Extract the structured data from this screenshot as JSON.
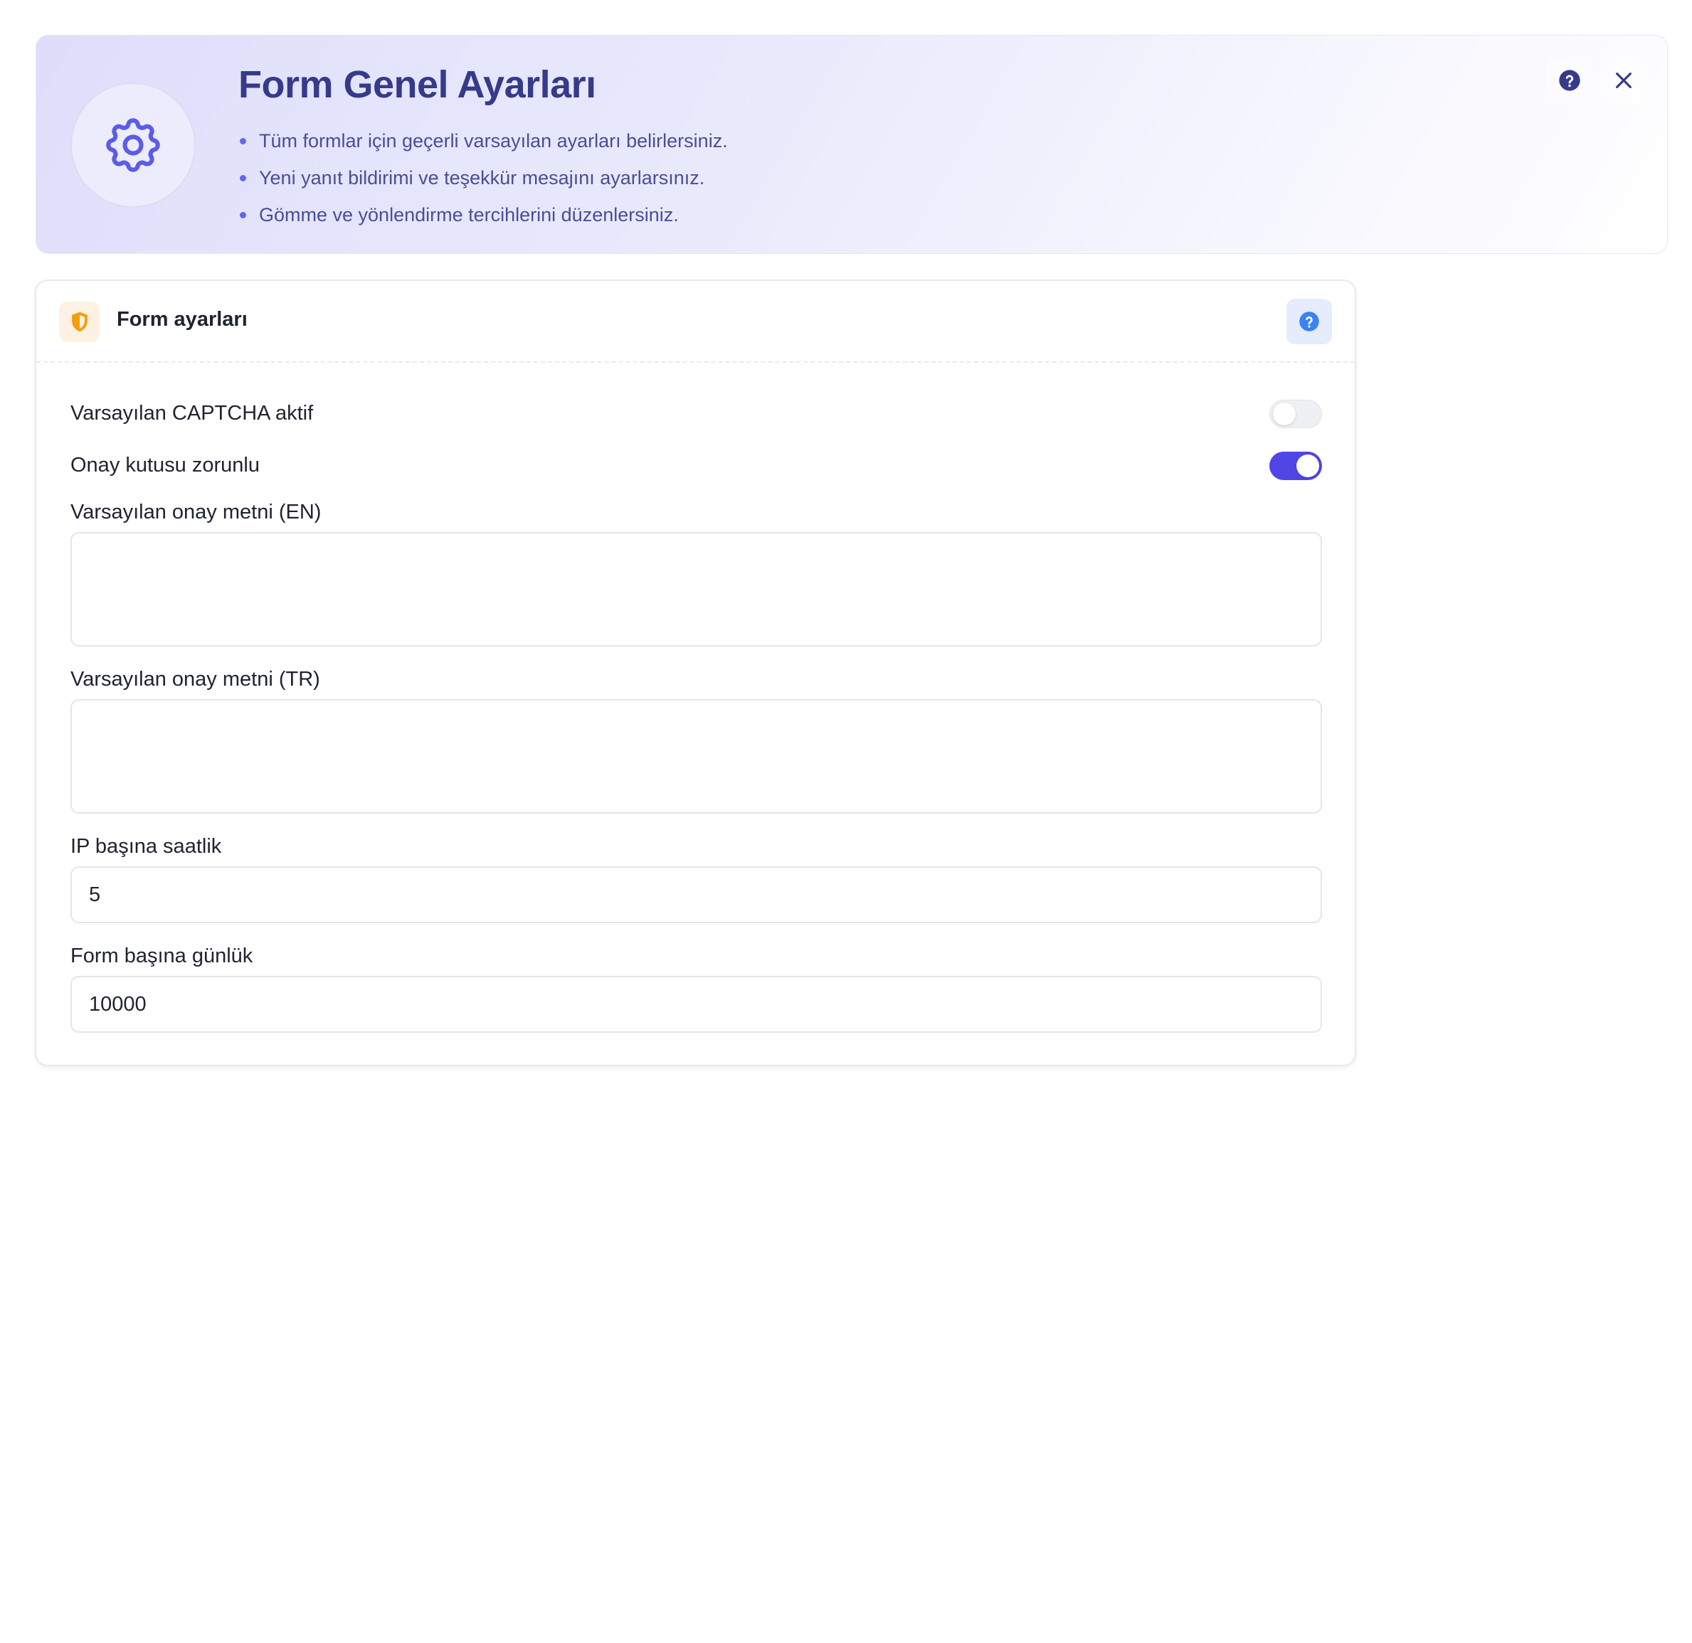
{
  "hero": {
    "title": "Form Genel Ayarları",
    "bullets": [
      "Tüm formlar için geçerli varsayılan ayarları belirlersiniz.",
      "Yeni yanıt bildirimi ve teşekkür mesajını ayarlarsınız.",
      "Gömme ve yönlendirme tercihlerini düzenlersiniz."
    ],
    "icon": "gear-icon",
    "actions": [
      "help-circle-icon",
      "close-icon"
    ]
  },
  "card": {
    "title": "Form ayarları",
    "header_icon": "shield-icon",
    "help_icon": "help-circle-icon",
    "fields": {
      "captcha": {
        "label": "Varsayılan CAPTCHA aktif",
        "enabled": false
      },
      "consent_required": {
        "label": "Onay kutusu zorunlu",
        "enabled": true
      },
      "consent_text_en": {
        "label": "Varsayılan onay metni (EN)",
        "value": ""
      },
      "consent_text_tr": {
        "label": "Varsayılan onay metni (TR)",
        "value": ""
      },
      "per_ip_hourly": {
        "label": "IP başına saatlik",
        "value": "5"
      },
      "per_form_daily": {
        "label": "Form başına günlük",
        "value": "10000"
      }
    }
  },
  "colors": {
    "accent": "#4f46e5",
    "hero_title": "#363a8a",
    "hero_text": "#4a4d97",
    "shield": "#f59e0b",
    "help_blue": "#3b82f6"
  }
}
